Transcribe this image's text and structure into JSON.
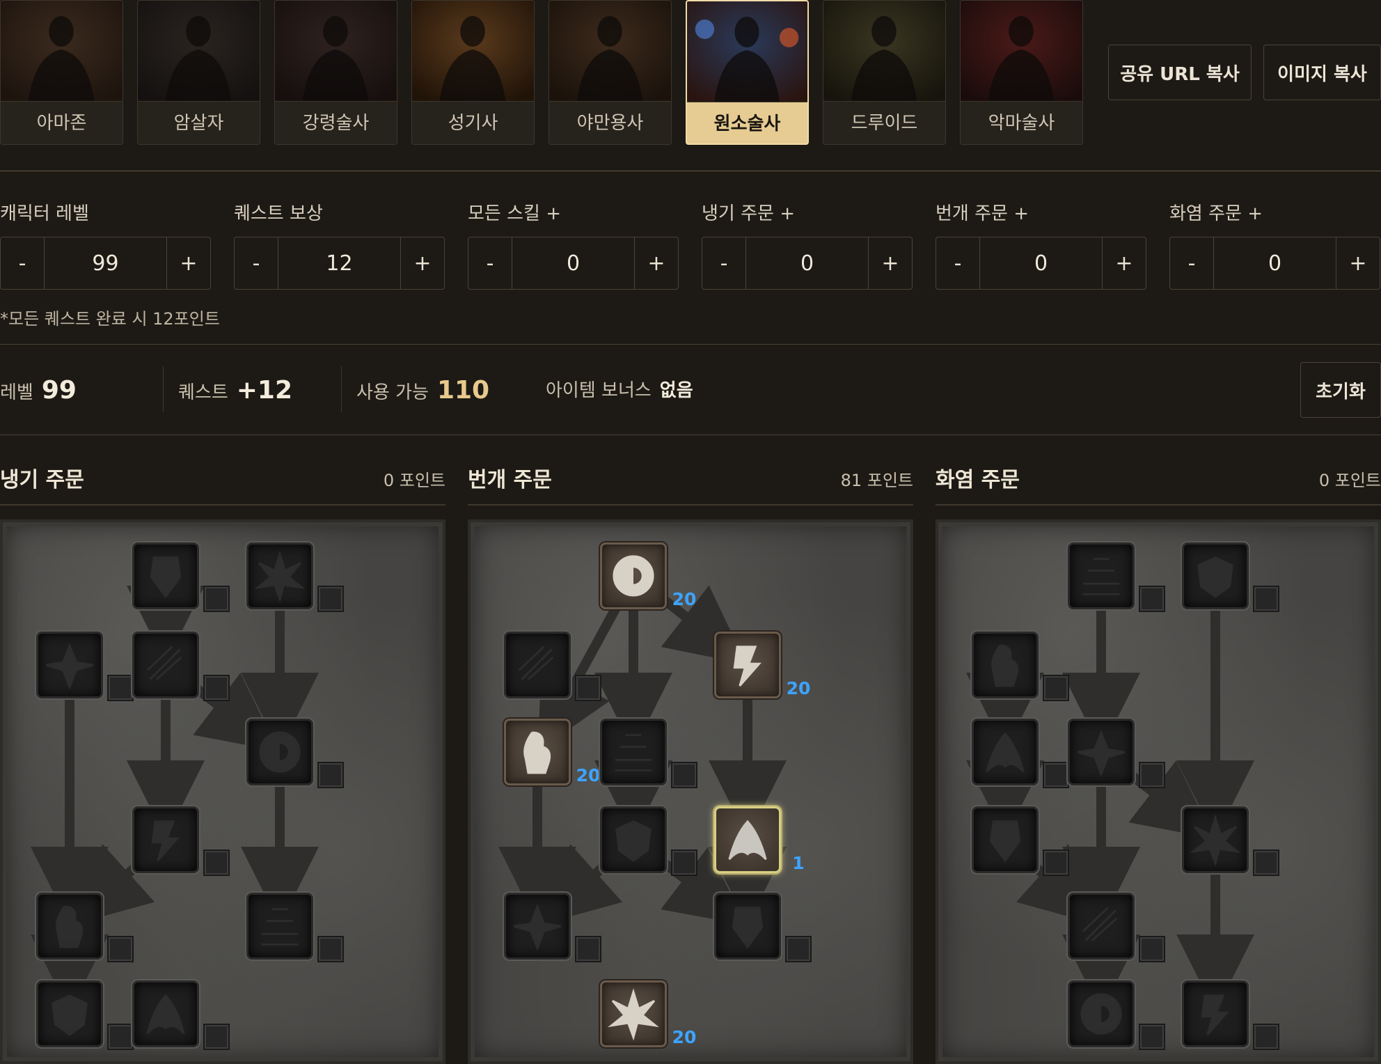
{
  "classes": [
    {
      "label": "아마존",
      "active": false
    },
    {
      "label": "암살자",
      "active": false
    },
    {
      "label": "강령술사",
      "active": false
    },
    {
      "label": "성기사",
      "active": false
    },
    {
      "label": "야만용사",
      "active": false
    },
    {
      "label": "원소술사",
      "active": true
    },
    {
      "label": "드루이드",
      "active": false
    },
    {
      "label": "악마술사",
      "active": false
    }
  ],
  "toolbar": {
    "share_url": "공유 URL 복사",
    "copy_image": "이미지 복사"
  },
  "stats": [
    {
      "label": "캐릭터 레벨",
      "value": "99",
      "minus": "-",
      "plus": "+"
    },
    {
      "label": "퀘스트 보상",
      "value": "12",
      "minus": "-",
      "plus": "+"
    },
    {
      "label": "모든 스킬 +",
      "value": "0",
      "minus": "-",
      "plus": "+"
    },
    {
      "label": "냉기 주문 +",
      "value": "0",
      "minus": "-",
      "plus": "+"
    },
    {
      "label": "번개 주문 +",
      "value": "0",
      "minus": "-",
      "plus": "+"
    },
    {
      "label": "화염 주문 +",
      "value": "0",
      "minus": "-",
      "plus": "+"
    }
  ],
  "quest_note": "*모든 퀘스트 완료 시 12포인트",
  "summary": {
    "level_label": "레벨",
    "level_value": "99",
    "quest_label": "퀘스트",
    "quest_value": "+12",
    "available_label": "사용 가능",
    "available_value": "110",
    "item_bonus_label": "아이템 보너스",
    "item_bonus_value": "없음",
    "reset_label": "초기화"
  },
  "trees": [
    {
      "title": "냉기 주문",
      "points": "0 포인트",
      "skills": [
        {
          "icon": "ice-bolt-icon",
          "level": ""
        },
        {
          "icon": "frozen-armor-icon",
          "level": ""
        },
        {
          "icon": "frost-nova-icon",
          "level": ""
        },
        {
          "icon": "ice-blast-icon",
          "level": ""
        },
        {
          "icon": "shiver-armor-icon",
          "level": ""
        },
        {
          "icon": "glacial-spike-icon",
          "level": ""
        },
        {
          "icon": "blizzard-icon",
          "level": ""
        },
        {
          "icon": "chilling-armor-icon",
          "level": ""
        },
        {
          "icon": "frozen-orb-icon",
          "level": ""
        },
        {
          "icon": "cold-mastery-icon",
          "level": ""
        }
      ]
    },
    {
      "title": "번개 주문",
      "points": "81 포인트",
      "skills": [
        {
          "icon": "charged-bolt-icon",
          "level": ""
        },
        {
          "icon": "static-field-icon",
          "level": "20"
        },
        {
          "icon": "telekinesis-icon",
          "level": "20"
        },
        {
          "icon": "nova-icon",
          "level": "20"
        },
        {
          "icon": "lightning-icon",
          "level": ""
        },
        {
          "icon": "chain-lightning-icon",
          "level": ""
        },
        {
          "icon": "teleport-icon",
          "level": "1"
        },
        {
          "icon": "thunder-storm-icon",
          "level": ""
        },
        {
          "icon": "energy-shield-icon",
          "level": ""
        },
        {
          "icon": "lightning-mastery-icon",
          "level": "20"
        }
      ]
    },
    {
      "title": "화염 주문",
      "points": "0 포인트",
      "skills": [
        {
          "icon": "fire-bolt-icon",
          "level": ""
        },
        {
          "icon": "warmth-icon",
          "level": ""
        },
        {
          "icon": "inferno-icon",
          "level": ""
        },
        {
          "icon": "blaze-icon",
          "level": ""
        },
        {
          "icon": "fire-ball-icon",
          "level": ""
        },
        {
          "icon": "fire-wall-icon",
          "level": ""
        },
        {
          "icon": "enchant-icon",
          "level": ""
        },
        {
          "icon": "meteor-icon",
          "level": ""
        },
        {
          "icon": "fire-mastery-icon",
          "level": ""
        },
        {
          "icon": "hydra-icon",
          "level": ""
        }
      ]
    }
  ],
  "colors": {
    "accent": "#e6cc93",
    "level_text": "#3da4ff",
    "available": "#e8c98e"
  }
}
